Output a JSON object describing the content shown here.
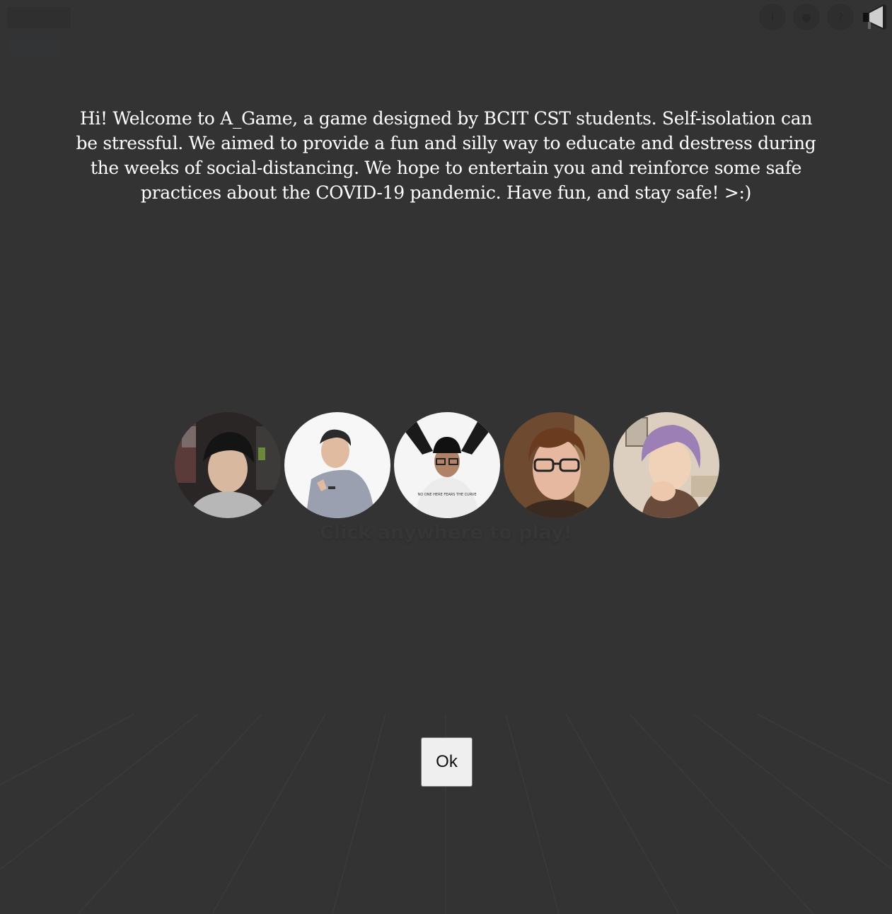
{
  "game": {
    "title": "",
    "subtitle": "",
    "click_hint": "Click anywhere to play!"
  },
  "toolbar": {
    "icons": [
      "info-icon",
      "user-icon",
      "help-icon",
      "megaphone-icon"
    ]
  },
  "dialog": {
    "message": "Hi! Welcome to A_Game, a game designed by BCIT CST students. Self-isolation can be stressful. We aimed to provide a fun and silly way to educate and destress during the weeks of social-distancing. We hope to entertain you and reinforce some safe practices about the COVID-19 pandemic. Have fun, and stay safe! >:)",
    "ok_label": "Ok"
  },
  "team": {
    "members": [
      {
        "name": "member-1"
      },
      {
        "name": "member-2"
      },
      {
        "name": "member-3"
      },
      {
        "name": "member-4"
      },
      {
        "name": "member-5"
      }
    ]
  },
  "colors": {
    "background": "#333333",
    "text": "#ffffff",
    "button": "#efefef"
  }
}
